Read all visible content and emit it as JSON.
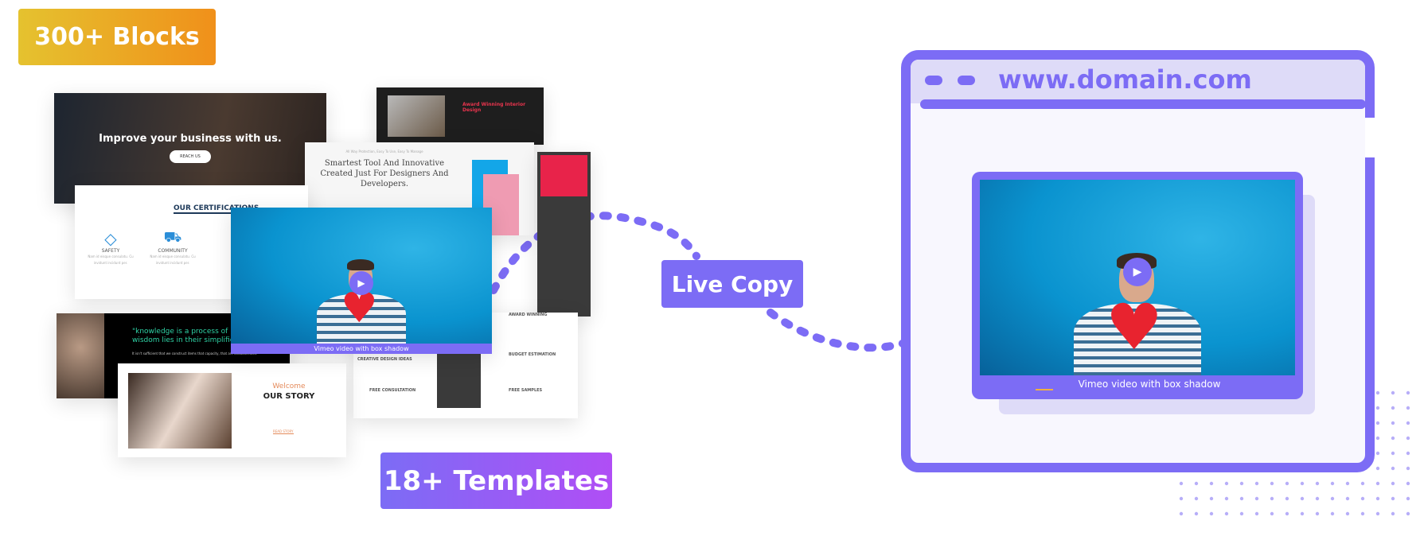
{
  "badges": {
    "blocks": "300+ Blocks",
    "templates": "18+ Templates",
    "live_copy": "Live Copy"
  },
  "browser": {
    "url": "www.domain.com",
    "video_caption": "Vimeo video with box shadow"
  },
  "collage": {
    "business": {
      "headline": "Improve your business with us.",
      "button": "REACH US"
    },
    "certifications": {
      "title": "OUR CERTIFICATIONS",
      "items": [
        {
          "label": "SAFETY",
          "text": "Nam id eisque consulatu. Cu invidunt incidunt per."
        },
        {
          "label": "COMMUNITY",
          "text": "Nam id eisque consulatu. Cu invidunt incidunt per."
        }
      ]
    },
    "interior": {
      "title": "Award Winning Interior Design"
    },
    "smartest": {
      "kicker": "All Way Protection, Easy To Use, Easy To Manage",
      "title": "Smartest Tool And Innovative Created Just For Designers And Developers."
    },
    "video": {
      "caption": "Vimeo video with box shadow"
    },
    "quote": {
      "text": "\"knowledge is a process of piling up facts; wisdom lies in their simplification\"",
      "sub": "It isn't sufficient that we construct items that capacity, that are unadulterated"
    },
    "story": {
      "kicker": "Welcome",
      "title": "OUR STORY",
      "button": "READ STORY"
    },
    "services": {
      "items": [
        "AWARD WINNING",
        "CREATIVE DESIGN IDEAS",
        "BUDGET ESTIMATION",
        "FREE CONSULTATION",
        "FREE SAMPLES"
      ]
    }
  },
  "colors": {
    "accent": "#7c6cf5",
    "browser_bg": "#f8f7fe",
    "browser_bar": "#dedbf8",
    "orange_start": "#e5c22f",
    "orange_end": "#f0901a",
    "purple_start": "#7c6cf5",
    "purple_end": "#b04ef5"
  }
}
